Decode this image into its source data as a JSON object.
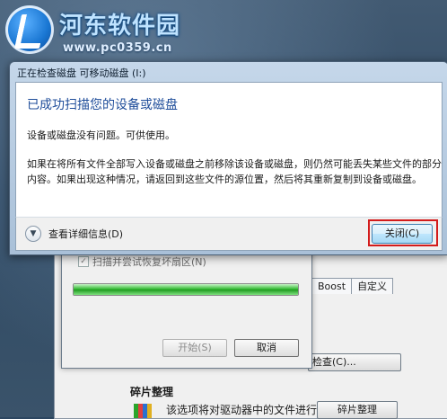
{
  "watermark": {
    "title": "河东软件园",
    "url": "www.pc0359.cn"
  },
  "dialog": {
    "window_title": "正在检查磁盘 可移动磁盘 (I:)",
    "heading": "已成功扫描您的设备或磁盘",
    "message_1": "设备或磁盘没有问题。可供使用。",
    "message_2": "如果在将所有文件全部写入设备或磁盘之前移除该设备或磁盘，则仍然可能丢失某些文件的部分内容。如果出现这种情况，请返回到这些文件的源位置，然后将其重新复制到设备或磁盘。",
    "details_label": "查看详细信息(D)",
    "close_label": "关闭(C)"
  },
  "scan_window": {
    "option_label": "扫描并尝试恢复坏扇区(N)",
    "progress_fraction": 1.0,
    "start_label": "开始(S)",
    "cancel_label": "取消"
  },
  "properties": {
    "tabs": [
      "Boost",
      "自定义"
    ],
    "check_now_label": "检查(C)...",
    "defrag_group_label": "碎片整理",
    "defrag_description": "该选项将对驱动器中的文件进行碎片整理",
    "defrag_button_label": "碎片整理"
  }
}
